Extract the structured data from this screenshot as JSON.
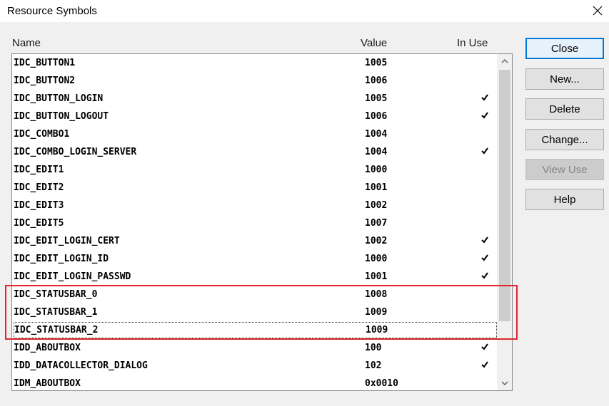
{
  "window": {
    "title": "Resource Symbols"
  },
  "columns": {
    "name": "Name",
    "value": "Value",
    "in_use": "In Use"
  },
  "rows": [
    {
      "name": "IDC_BUTTON1",
      "value": "1005",
      "in_use": false
    },
    {
      "name": "IDC_BUTTON2",
      "value": "1006",
      "in_use": false
    },
    {
      "name": "IDC_BUTTON_LOGIN",
      "value": "1005",
      "in_use": true
    },
    {
      "name": "IDC_BUTTON_LOGOUT",
      "value": "1006",
      "in_use": true
    },
    {
      "name": "IDC_COMBO1",
      "value": "1004",
      "in_use": false
    },
    {
      "name": "IDC_COMBO_LOGIN_SERVER",
      "value": "1004",
      "in_use": true
    },
    {
      "name": "IDC_EDIT1",
      "value": "1000",
      "in_use": false
    },
    {
      "name": "IDC_EDIT2",
      "value": "1001",
      "in_use": false
    },
    {
      "name": "IDC_EDIT3",
      "value": "1002",
      "in_use": false
    },
    {
      "name": "IDC_EDIT5",
      "value": "1007",
      "in_use": false
    },
    {
      "name": "IDC_EDIT_LOGIN_CERT",
      "value": "1002",
      "in_use": true
    },
    {
      "name": "IDC_EDIT_LOGIN_ID",
      "value": "1000",
      "in_use": true
    },
    {
      "name": "IDC_EDIT_LOGIN_PASSWD",
      "value": "1001",
      "in_use": true
    },
    {
      "name": "IDC_STATUSBAR_0",
      "value": "1008",
      "in_use": false
    },
    {
      "name": "IDC_STATUSBAR_1",
      "value": "1009",
      "in_use": false
    },
    {
      "name": "IDC_STATUSBAR_2",
      "value": "1009",
      "in_use": false,
      "focused": true
    },
    {
      "name": "IDD_ABOUTBOX",
      "value": "100",
      "in_use": true
    },
    {
      "name": "IDD_DATACOLLECTOR_DIALOG",
      "value": "102",
      "in_use": true
    },
    {
      "name": "IDM_ABOUTBOX",
      "value": "0x0010",
      "in_use": false
    }
  ],
  "buttons": {
    "close": "Close",
    "new": "New...",
    "delete": "Delete",
    "change": "Change...",
    "view_use": "View Use",
    "help": "Help"
  },
  "icons": {
    "window_close": "close-icon",
    "check": "checkmark-icon",
    "scroll_up": "chevron-up-icon",
    "scroll_down": "chevron-down-icon"
  },
  "colors": {
    "highlight_border": "#e0262b",
    "default_button_border": "#0078d7"
  }
}
